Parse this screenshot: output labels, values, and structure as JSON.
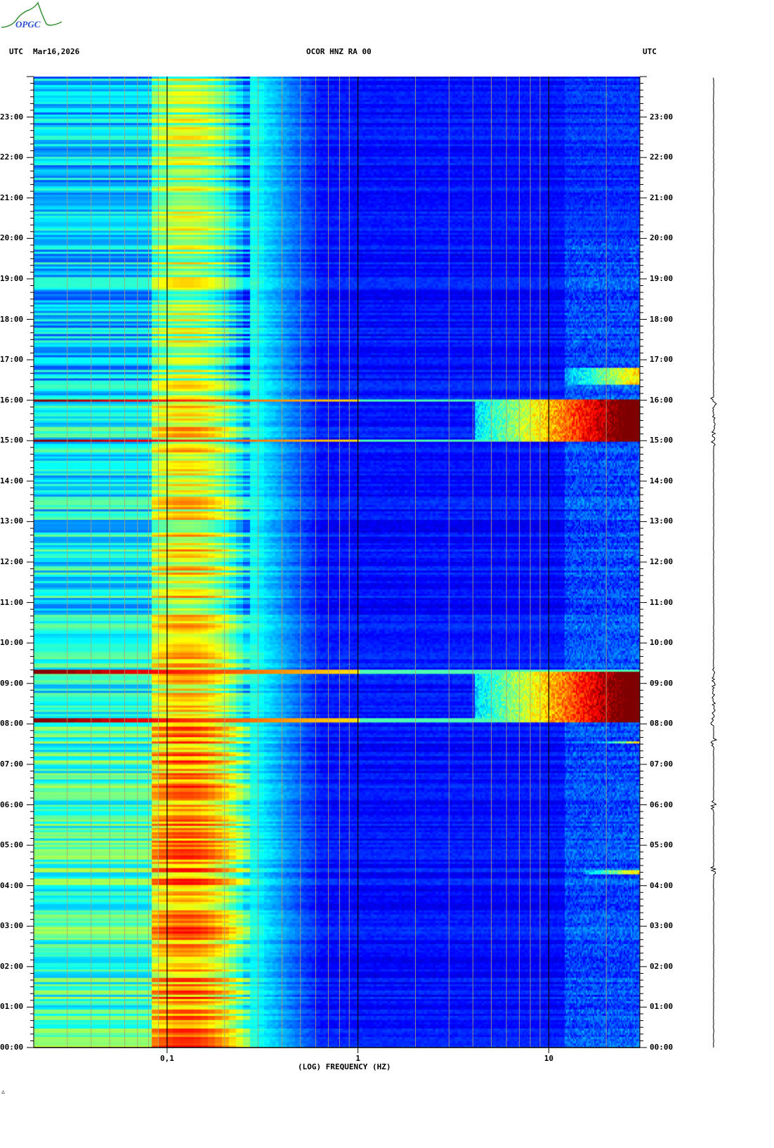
{
  "logo": {
    "text": "OPGC",
    "colors": {
      "arc": "#3a8f3a",
      "text": "#2a4fd0"
    }
  },
  "header": {
    "left_tz": "UTC",
    "date": "Mar16,2026",
    "station": "OCOR HNZ RA 00",
    "right_tz": "UTC"
  },
  "footer_mark": "∴",
  "chart_data": {
    "type": "heatmap",
    "title": "OCOR HNZ RA 00",
    "subtitle": "Mar16,2026",
    "xlabel": "(LOG) FREQUENCY (HZ)",
    "ylabel": "UTC",
    "xscale": "log",
    "xlim": [
      0.02,
      30
    ],
    "x_ticks": [
      {
        "value": 0.1,
        "label": "0,1"
      },
      {
        "value": 1,
        "label": "1"
      },
      {
        "value": 10,
        "label": "10"
      }
    ],
    "ylim_hours": [
      0,
      24
    ],
    "y_ticks": [
      "00:00",
      "01:00",
      "02:00",
      "03:00",
      "04:00",
      "05:00",
      "06:00",
      "07:00",
      "08:00",
      "09:00",
      "10:00",
      "11:00",
      "12:00",
      "13:00",
      "14:00",
      "15:00",
      "16:00",
      "17:00",
      "18:00",
      "19:00",
      "20:00",
      "21:00",
      "22:00",
      "23:00"
    ],
    "colormap": "jet",
    "microseism_peak_hz": 0.12,
    "events": [
      {
        "start_h": 8.05,
        "end_h": 9.3,
        "band_hz": [
          4,
          30
        ],
        "level": "high"
      },
      {
        "start_h": 15.0,
        "end_h": 16.0,
        "band_hz": [
          4,
          30
        ],
        "level": "high"
      },
      {
        "start_h": 7.5,
        "end_h": 7.55,
        "band_hz": [
          18,
          30
        ],
        "level": "medium"
      },
      {
        "start_h": 4.3,
        "end_h": 4.4,
        "band_hz": [
          15,
          30
        ],
        "level": "medium"
      },
      {
        "start_h": 16.4,
        "end_h": 16.8,
        "band_hz": [
          12,
          30
        ],
        "level": "medium"
      }
    ],
    "trace_events_h": [
      4.4,
      6.0,
      7.55,
      8.1,
      9.3,
      15.0,
      16.0
    ]
  }
}
